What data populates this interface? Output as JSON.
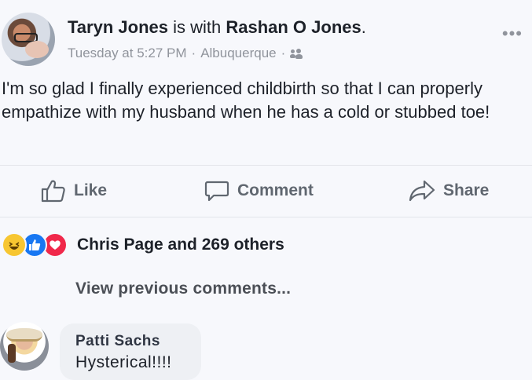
{
  "post": {
    "author": "Taryn Jones",
    "with_word": " is with ",
    "tagged": "Rashan O Jones",
    "end_period": ".",
    "timestamp": "Tuesday at 5:27 PM",
    "separator": "·",
    "location": "Albuquerque",
    "audience_icon": "friends-icon",
    "more_icon": "•••",
    "text": "I'm so glad I finally experienced childbirth so that I can properly empathize with my husband when he has a cold or stubbed toe!"
  },
  "actions": {
    "like": "Like",
    "comment": "Comment",
    "share": "Share"
  },
  "reactions": {
    "icons": [
      "haha",
      "like",
      "love"
    ],
    "summary": "Chris Page and 269 others"
  },
  "comments": {
    "view_previous": "View previous comments...",
    "items": [
      {
        "name": "Patti Sachs",
        "text": "Hysterical!!!!"
      }
    ]
  },
  "colors": {
    "background": "#f7f8fc",
    "secondary_text": "#90949c",
    "like_blue": "#1877f2",
    "love_red": "#f0284a",
    "haha_yellow": "#f7c631"
  }
}
